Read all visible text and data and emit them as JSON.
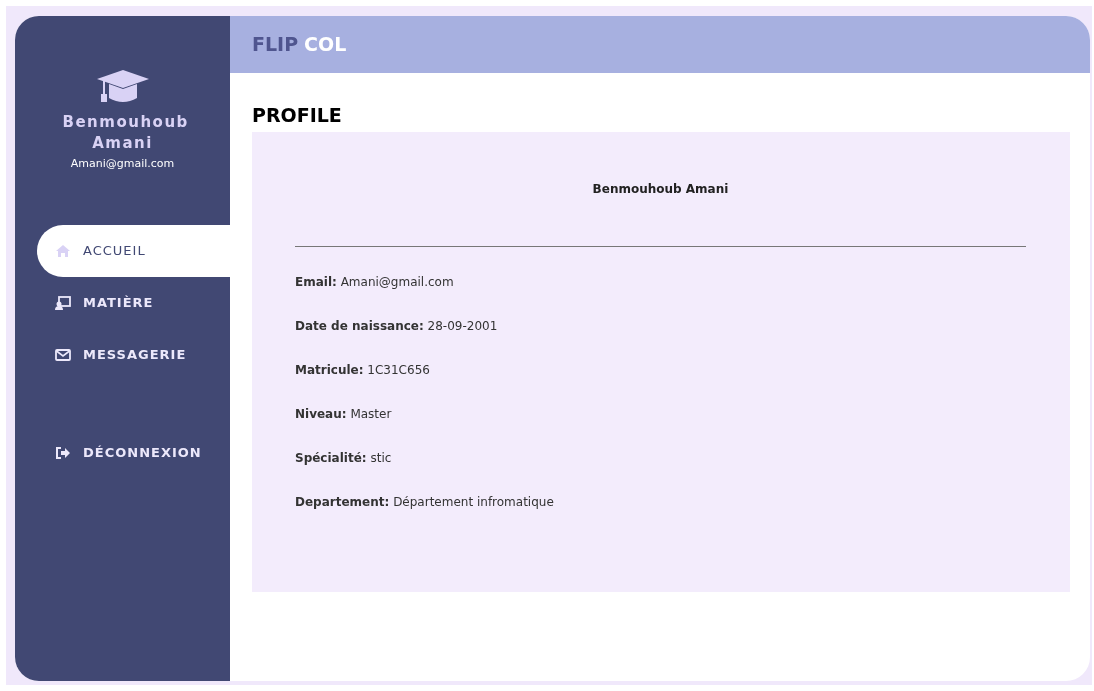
{
  "sidebar": {
    "user_name": "Benmouhoub Amani",
    "user_email": "Amani@gmail.com",
    "items": [
      {
        "label": "ACCUEIL",
        "selected": true
      },
      {
        "label": "MATIÈRE",
        "selected": false
      },
      {
        "label": "MESSAGERIE",
        "selected": false
      },
      {
        "label": "DÉCONNEXION",
        "selected": false
      }
    ]
  },
  "header": {
    "brand_part_1": "FLIP",
    "brand_part_2": "COL"
  },
  "page_title": "PROFILE",
  "profile": {
    "name": "Benmouhoub Amani",
    "fields": [
      "**Email:** Amani@gmail.com",
      "**Date de naissance:** 28-09-2001",
      "**Matricule:** 1C31C656",
      "**Niveau:** Master",
      "**Spécialité:** stic",
      "**Departement:** Département infromatique"
    ]
  }
}
